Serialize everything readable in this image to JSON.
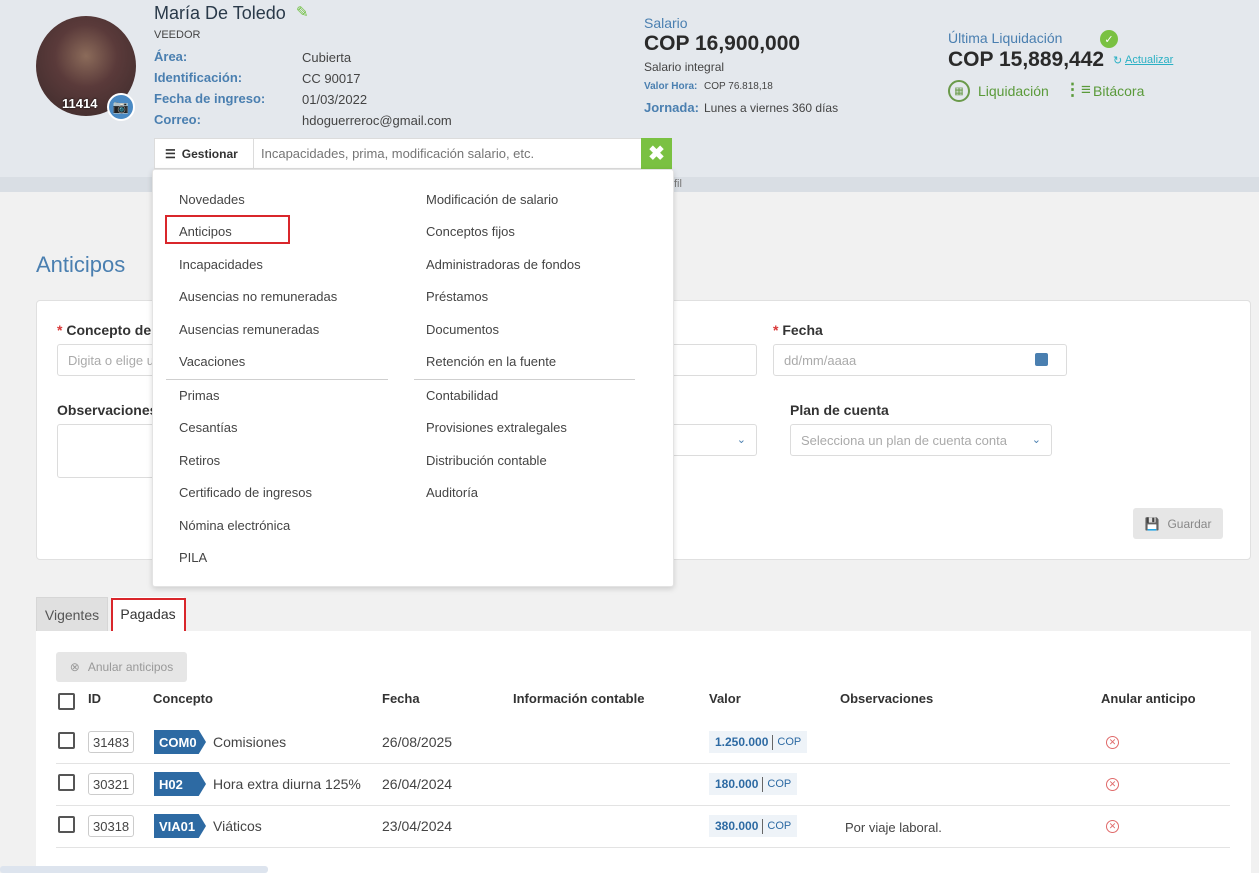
{
  "employee": {
    "name": "María De Toledo",
    "role": "VEEDOR",
    "avatar_id": "11414",
    "fields": [
      {
        "label": "Área:",
        "value": "Cubierta"
      },
      {
        "label": "Identificación:",
        "value": "CC 90017"
      },
      {
        "label": "Fecha de ingreso:",
        "value": "01/03/2022"
      },
      {
        "label": "Correo:",
        "value": "hdoguerreroc@gmail.com"
      }
    ]
  },
  "salary": {
    "label": "Salario",
    "value": "COP 16,900,000",
    "type": "Salario integral",
    "hourly_label": "Valor Hora:",
    "hourly_value": "COP 76.818,18",
    "schedule_label": "Jornada:",
    "schedule_value": "Lunes a viernes 360 días"
  },
  "liquidation": {
    "label": "Última Liquidación",
    "value": "COP 15,889,442",
    "refresh_label": "Actualizar",
    "liq_link": "Liquidación",
    "bitacora_link": "Bitácora"
  },
  "manage": {
    "button_label": "Gestionar",
    "placeholder": "Incapacidades, prima, modificación salario, etc.",
    "strip_text": "fil"
  },
  "menu": {
    "left": [
      "Novedades",
      "Anticipos",
      "Incapacidades",
      "Ausencias no remuneradas",
      "Ausencias remuneradas",
      "Vacaciones",
      "Primas",
      "Cesantías",
      "Retiros",
      "Certificado de ingresos",
      "Nómina electrónica",
      "PILA"
    ],
    "right": [
      "Modificación de salario",
      "Conceptos fijos",
      "Administradoras de fondos",
      "Préstamos",
      "Documentos",
      "Retención en la fuente",
      "Contabilidad",
      "Provisiones extralegales",
      "Distribución contable",
      "Auditoría"
    ]
  },
  "section_title": "Anticipos",
  "form": {
    "concept_label": "Concepto de n",
    "concept_placeholder": "Digita o elige u",
    "date_label": "Fecha",
    "date_placeholder": "dd/mm/aaaa",
    "obs_label": "Observaciones",
    "plan_label": "Plan de cuenta",
    "plan_placeholder": "Selecciona un plan de cuenta conta",
    "save_label": "Guardar"
  },
  "tabs": [
    "Vigentes",
    "Pagadas"
  ],
  "table": {
    "void_button": "Anular anticipos",
    "headers": [
      "ID",
      "Concepto",
      "Fecha",
      "Información contable",
      "Valor",
      "Observaciones",
      "Anular anticipo"
    ],
    "rows": [
      {
        "id": "31483",
        "code": "COM0",
        "concept": "Comisiones",
        "date": "26/08/2025",
        "amount": "1.250.000",
        "currency": "COP",
        "obs": ""
      },
      {
        "id": "30321",
        "code": "H02",
        "concept": "Hora extra diurna 125%",
        "date": "26/04/2024",
        "amount": "180.000",
        "currency": "COP",
        "obs": ""
      },
      {
        "id": "30318",
        "code": "VIA01",
        "concept": "Viáticos",
        "date": "23/04/2024",
        "amount": "380.000",
        "currency": "COP",
        "obs": "Por viaje laboral."
      }
    ]
  },
  "colors": {
    "primary_blue": "#4a7fb0",
    "accent_green": "#7ac142",
    "highlight_red": "#d9262b",
    "tag_blue": "#2d6aa3"
  }
}
